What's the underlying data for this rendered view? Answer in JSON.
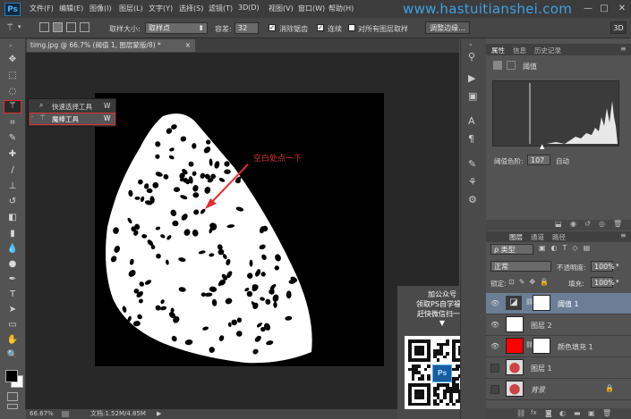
{
  "menubar": {
    "app_logo": "Ps",
    "items": [
      "文件(F)",
      "编辑(E)",
      "图像(I)",
      "图层(L)",
      "文字(Y)",
      "选择(S)",
      "滤镜(T)",
      "3D(D)",
      "视图(V)",
      "窗口(W)",
      "帮助(H)"
    ],
    "watermark": "www.hastuitianshei.com",
    "window_buttons": [
      "—",
      "□",
      "✕"
    ]
  },
  "options": {
    "sample_size_label": "取样大小:",
    "sample_size_value": "取样点",
    "tolerance_label": "容差:",
    "tolerance_value": "32",
    "antialias_label": "消除锯齿",
    "contiguous_label": "连续",
    "sample_all_label": "对所有图层取样",
    "refine_edge_button": "调整边缘...",
    "mode_3d": "3D"
  },
  "document": {
    "tab_title": "timg.jpg @ 66.7% (阈值 1, 图层蒙版/8) *",
    "close": "×"
  },
  "flyout": {
    "items": [
      {
        "label": "快速选择工具",
        "shortcut": "W"
      },
      {
        "label": "魔棒工具",
        "shortcut": "W"
      }
    ]
  },
  "canvas": {
    "annotation": "空白处点一下"
  },
  "statusbar": {
    "zoom": "66.67%",
    "doc_info": "文档:1.52M/4.85M",
    "arrow": "▶"
  },
  "properties_panel": {
    "tabs": [
      "属性",
      "信息",
      "历史记录"
    ],
    "header": "阈值",
    "threshold_label": "阈值色阶:",
    "threshold_value": "107",
    "auto_label": "自动"
  },
  "layers_panel": {
    "tabs": [
      "图层",
      "通道",
      "路径"
    ],
    "filter_label": "ρ 类型",
    "blend_mode": "正常",
    "opacity_label": "不透明度:",
    "opacity_value": "100%",
    "lock_label": "锁定:",
    "fill_label": "填充:",
    "fill_value": "100%",
    "layers": [
      {
        "name": "阈值 1",
        "selected": true,
        "type": "adjustment"
      },
      {
        "name": "图层 2",
        "selected": false,
        "type": "white"
      },
      {
        "name": "颜色填充 1",
        "selected": false,
        "type": "fill"
      },
      {
        "name": "图层 1",
        "selected": false,
        "type": "image"
      },
      {
        "name": "背景",
        "selected": false,
        "type": "image"
      }
    ],
    "bottom_icons": [
      "link-icon",
      "fx-icon",
      "mask-icon",
      "adjust-icon",
      "folder-icon",
      "new-layer-icon",
      "trash-icon"
    ]
  },
  "promo": {
    "line1": "加公众号",
    "line2": "领取PS自学福利",
    "line3": "赶快微信扫一扫",
    "arrow": "▼",
    "badge": "Ps"
  },
  "colors": {
    "accent_red": "#e03131",
    "fill_red": "#ff0000",
    "watermark_blue": "#3da0e6",
    "selected_layer": "#6c7e96"
  }
}
